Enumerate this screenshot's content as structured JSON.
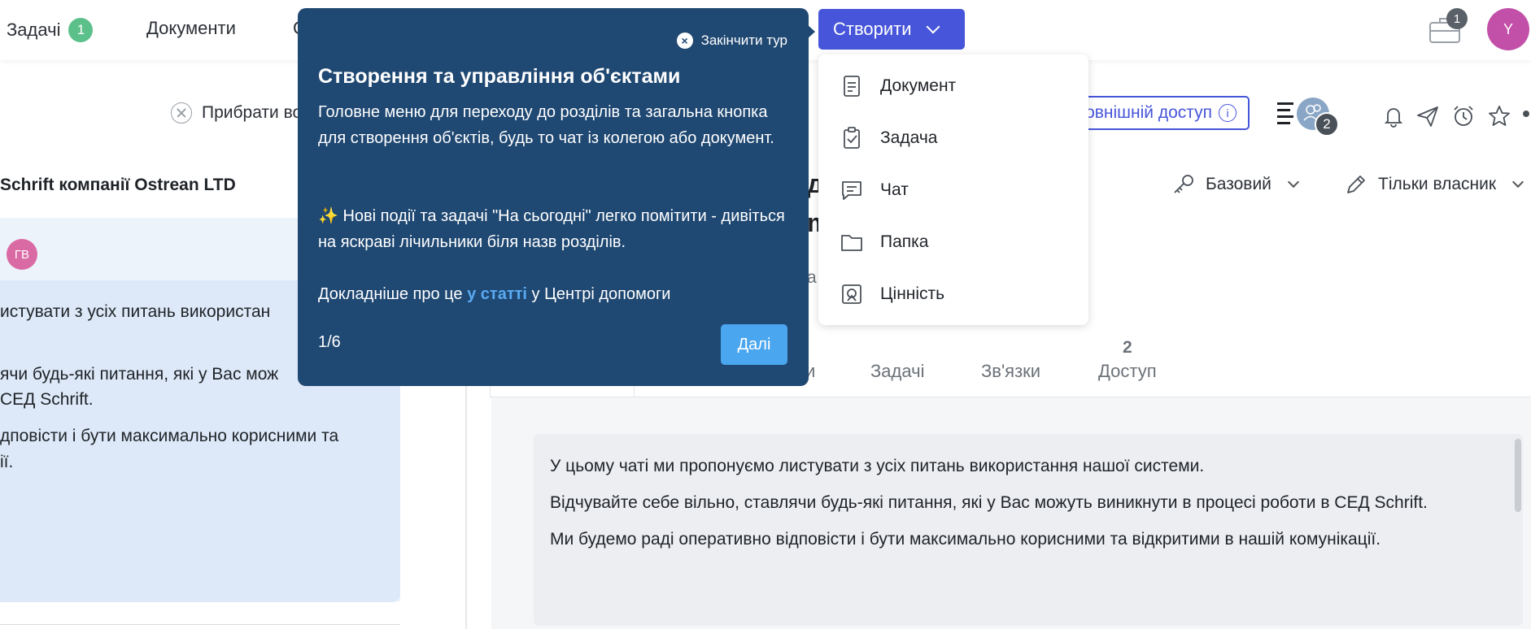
{
  "colors": {
    "accent": "#4655d9",
    "tour_bg": "#1f4872",
    "tour_link": "#5aaaf2",
    "tour_button": "#4aa6ef",
    "badge_green": "#5cc08a",
    "avatar_y": "#c24fa8",
    "avatar_gv": "#d96aa4"
  },
  "topnav": {
    "tasks_label": "Задачі",
    "tasks_badge": "1",
    "documents_label": "Документи",
    "partial_label": "С",
    "create_label": "Створити",
    "briefcase_badge": "1",
    "avatar_initial": "Y"
  },
  "create_menu": {
    "items": [
      {
        "label": "Документ",
        "icon": "document-icon"
      },
      {
        "label": "Задача",
        "icon": "task-icon"
      },
      {
        "label": "Чат",
        "icon": "chat-icon"
      },
      {
        "label": "Папка",
        "icon": "folder-icon"
      },
      {
        "label": "Цінність",
        "icon": "value-icon"
      }
    ]
  },
  "subbar": {
    "clear_label": "Прибрати во",
    "external_access_label": "овнішній доступ",
    "members_badge": "2"
  },
  "left_panel": {
    "title": "Schrift компанії Ostrean LTD",
    "avatar_initials": "ГВ",
    "lines": [
      "истувати з усіх питань використан",
      "ячи будь-які питання, які у Вас мож",
      "СЕД Schrift.",
      "дповісти і бути максимально корисними та",
      "ії."
    ]
  },
  "right_panel": {
    "heading_1": "д",
    "heading_2": "m",
    "field_fragment": "а",
    "access_level": "Базовий",
    "edit_rights": "Тільки власник",
    "tabs": [
      {
        "label": "и",
        "count": ""
      },
      {
        "label": "Задачі",
        "count": ""
      },
      {
        "label": "Зв'язки",
        "count": ""
      },
      {
        "label": "Доступ",
        "count": "2"
      }
    ],
    "message_lines": [
      "У цьому чаті ми пропонуємо листувати з усіх питань використання нашої системи.",
      "Відчувайте себе вільно, ставлячи будь-які питання, які у Вас можуть виникнути в процесі роботи в СЕД Schrift.",
      "Ми будемо раді оперативно відповісти і бути максимально корисними та відкритими в нашій комунікації."
    ]
  },
  "tour": {
    "end_label": "Закінчити тур",
    "title": "Створення та управління об'єктами",
    "paragraph_1": "Головне меню для переходу до розділів та загальна кнопка для створення об'єктів, будь то чат із колегою або документ.",
    "paragraph_2": "✨ Нові події та задачі \"На сьогодні\" легко помітити - дивіться на яскраві лічильники біля назв розділів.",
    "paragraph_3_before": "Докладніше про це ",
    "paragraph_3_link": "у статті",
    "paragraph_3_after": " у Центрі допомоги",
    "step": "1/6",
    "next_label": "Далі"
  }
}
